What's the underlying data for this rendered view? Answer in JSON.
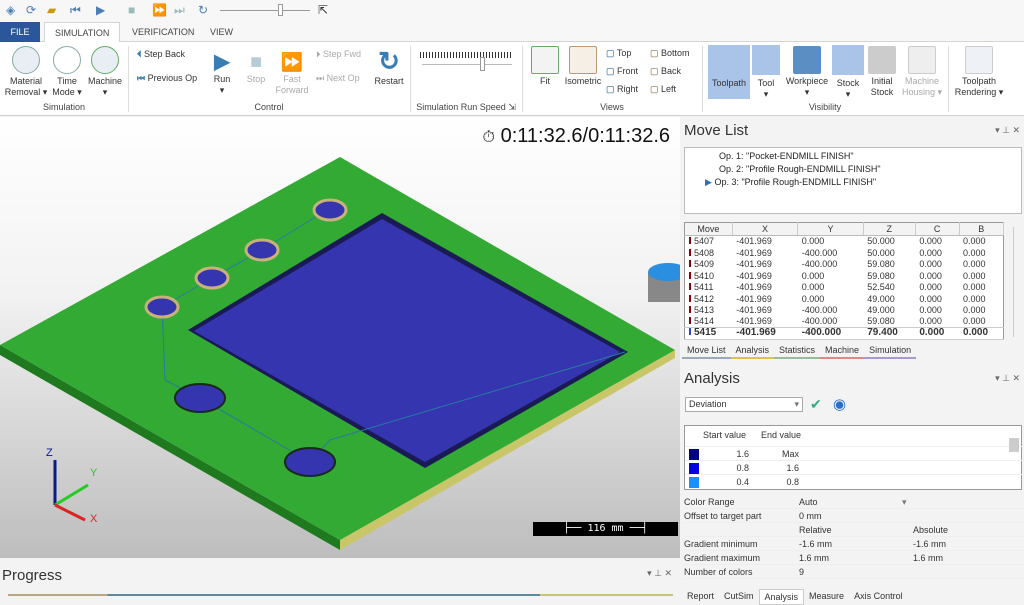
{
  "quick_access": {
    "icons": [
      "app-icon",
      "refresh-icon",
      "open-icon",
      "rewind-icon",
      "play-icon",
      "stop-icon",
      "fast-forward-icon",
      "skip-end-icon",
      "restart-icon",
      "pointer-icon"
    ]
  },
  "tabs": [
    "FILE",
    "SIMULATION",
    "VERIFICATION",
    "VIEW"
  ],
  "ribbon": {
    "simulation": {
      "group": "Simulation",
      "material_removal": "Material Removal",
      "time_mode": "Time Mode",
      "machine": "Machine"
    },
    "control": {
      "group": "Control",
      "step_back": "Step Back",
      "previous_op": "Previous Op",
      "run": "Run",
      "stop": "Stop",
      "fast_forward": "Fast Forward",
      "step_fwd": "Step Fwd",
      "next_op": "Next Op",
      "restart": "Restart"
    },
    "speed": {
      "group": "Simulation Run Speed"
    },
    "views": {
      "group": "Views",
      "fit": "Fit",
      "isometric": "Isometric",
      "top": "Top",
      "front": "Front",
      "right": "Right",
      "bottom": "Bottom",
      "back": "Back",
      "left": "Left"
    },
    "visibility": {
      "group": "Visibility",
      "toolpath": "Toolpath",
      "tool": "Tool",
      "workpiece": "Workpiece",
      "stock": "Stock",
      "initial_stock": "Initial Stock",
      "machine_housing": "Machine Housing"
    },
    "rendering": {
      "toolpath_rendering": "Toolpath Rendering"
    }
  },
  "viewport": {
    "timer": "0:11:32.6/0:11:32.6",
    "scale": "116 mm",
    "axes": {
      "x": "X",
      "y": "Y",
      "z": "Z"
    },
    "colors": {
      "stock": "#33aa33",
      "pocket": "#3333aa"
    }
  },
  "progress": {
    "title": "Progress"
  },
  "move_list": {
    "title": "Move List",
    "ops": [
      "Op. 1: \"Pocket-ENDMILL FINISH\"",
      "Op. 2: \"Profile Rough-ENDMILL FINISH\"",
      "Op. 3: \"Profile Rough-ENDMILL FINISH\""
    ],
    "columns": [
      "Move",
      "X",
      "Y",
      "Z",
      "C",
      "B"
    ],
    "rows": [
      [
        "5407",
        "-401.969",
        "0.000",
        "50.000",
        "0.000",
        "0.000"
      ],
      [
        "5408",
        "-401.969",
        "-400.000",
        "50.000",
        "0.000",
        "0.000"
      ],
      [
        "5409",
        "-401.969",
        "-400.000",
        "59.080",
        "0.000",
        "0.000"
      ],
      [
        "5410",
        "-401.969",
        "0.000",
        "59.080",
        "0.000",
        "0.000"
      ],
      [
        "5411",
        "-401.969",
        "0.000",
        "52.540",
        "0.000",
        "0.000"
      ],
      [
        "5412",
        "-401.969",
        "0.000",
        "49.000",
        "0.000",
        "0.000"
      ],
      [
        "5413",
        "-401.969",
        "-400.000",
        "49.000",
        "0.000",
        "0.000"
      ],
      [
        "5414",
        "-401.969",
        "-400.000",
        "59.080",
        "0.000",
        "0.000"
      ],
      [
        "5415",
        "-401.969",
        "-400.000",
        "79.400",
        "0.000",
        "0.000"
      ]
    ],
    "tabs": [
      "Move List",
      "Analysis",
      "Statistics",
      "Machine",
      "Simulation"
    ]
  },
  "analysis": {
    "title": "Analysis",
    "mode": "Deviation",
    "columns": [
      "Start value",
      "End value"
    ],
    "ranges": [
      {
        "color": "#000080",
        "start": "1.6",
        "end": "Max"
      },
      {
        "color": "#0000e0",
        "start": "0.8",
        "end": "1.6"
      },
      {
        "color": "#1a90ff",
        "start": "0.4",
        "end": "0.8"
      }
    ],
    "props": {
      "color_range_label": "Color Range",
      "color_range": "Auto",
      "offset_label": "Offset to target part",
      "offset": "0 mm",
      "relative": "Relative",
      "absolute": "Absolute",
      "gmin_label": "Gradient minimum",
      "gmin_rel": "-1.6 mm",
      "gmin_abs": "-1.6 mm",
      "gmax_label": "Gradient maximum",
      "gmax_rel": "1.6 mm",
      "gmax_abs": "1.6 mm",
      "ncolors_label": "Number of colors",
      "ncolors": "9"
    },
    "tabs": [
      "Report",
      "CutSim",
      "Analysis",
      "Measure",
      "Axis Control"
    ]
  }
}
